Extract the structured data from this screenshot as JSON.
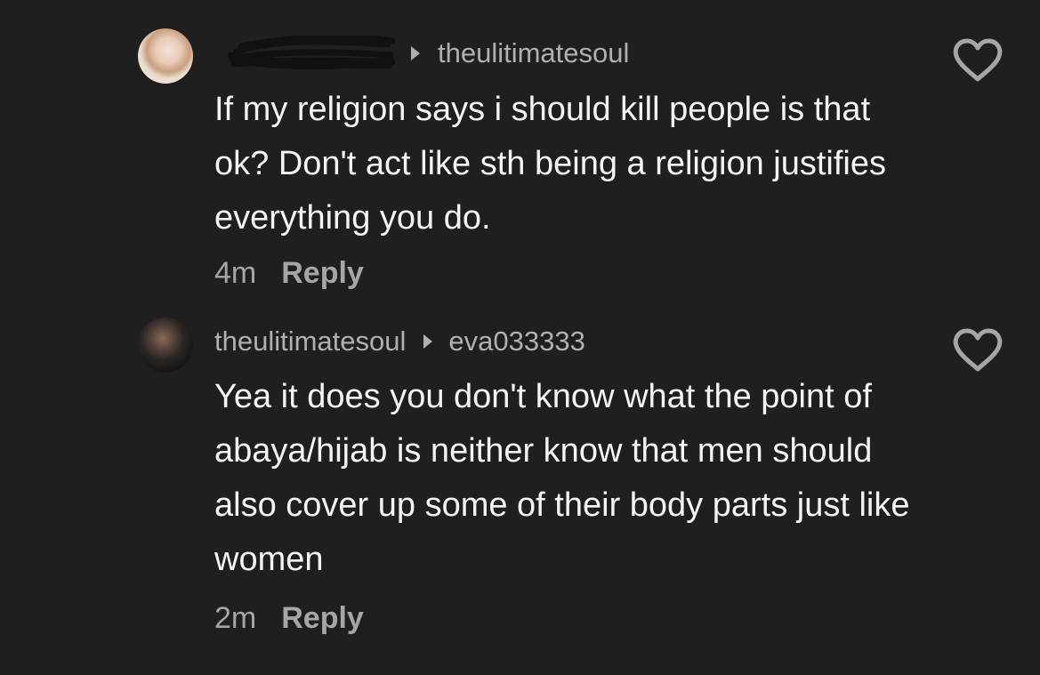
{
  "comments": [
    {
      "author": "",
      "reply_to": "theulitimatesoul",
      "text": "If my religion says i should kill people is that ok? Don't act like sth being a religion justifies everything you do.",
      "time": "4m",
      "reply_label": "Reply",
      "author_redacted": true
    },
    {
      "author": "theulitimatesoul",
      "reply_to": "eva033333",
      "text": "Yea it does you don't know what the point of abaya/hijab is neither know that men should also cover up some of their body parts just like women",
      "time": "2m",
      "reply_label": "Reply",
      "author_redacted": false
    }
  ],
  "icons": {
    "reply_arrow": "caret-right-icon",
    "like": "heart-outline-icon"
  },
  "colors": {
    "background": "#1f1f1f",
    "text": "#f4f4f4",
    "secondary_text": "#a6a6a6",
    "redaction": "#111111"
  }
}
